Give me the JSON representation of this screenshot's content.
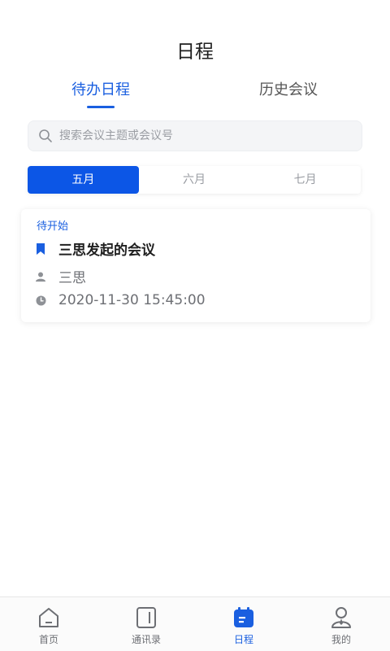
{
  "header": {
    "title": "日程"
  },
  "tabs": [
    {
      "label": "待办日程",
      "active": true
    },
    {
      "label": "历史会议",
      "active": false
    }
  ],
  "search": {
    "placeholder": "搜索会议主题或会议号",
    "value": ""
  },
  "months": [
    {
      "label": "五月",
      "active": true
    },
    {
      "label": "六月",
      "active": false
    },
    {
      "label": "七月",
      "active": false
    }
  ],
  "meeting": {
    "status": "待开始",
    "title": "三思发起的会议",
    "host": "三思",
    "time": "2020-11-30 15:45:00",
    "icons": {
      "title": "bookmark-icon",
      "host": "person-icon",
      "time": "clock-icon"
    }
  },
  "tabbar": [
    {
      "label": "首页",
      "icon": "home-icon",
      "active": false
    },
    {
      "label": "通讯录",
      "icon": "contacts-icon",
      "active": false
    },
    {
      "label": "日程",
      "icon": "calendar-icon",
      "active": true
    },
    {
      "label": "我的",
      "icon": "profile-icon",
      "active": false
    }
  ],
  "colors": {
    "accent": "#1a5fe0",
    "month_active_bg": "#0c56e6",
    "muted": "#9a9da3"
  }
}
